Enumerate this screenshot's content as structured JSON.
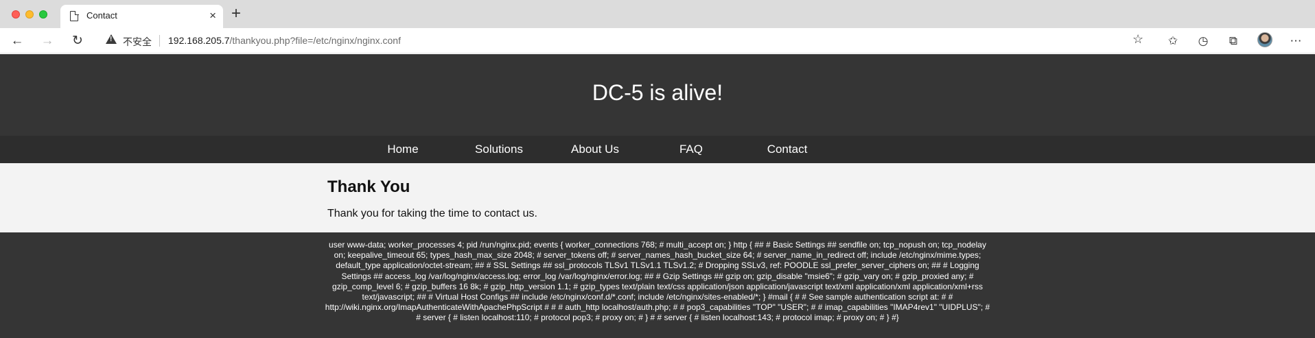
{
  "browser": {
    "tab_title": "Contact",
    "tab_close": "×",
    "new_tab": "+",
    "security_label": "不安全",
    "url_host": "192.168.205.7",
    "url_path": "/thankyou.php?file=/etc/nginx/nginx.conf",
    "icons": [
      "back-icon",
      "forward-icon",
      "reload-icon",
      "warning-icon",
      "add-favorite-icon",
      "favorites-icon",
      "history-icon",
      "collections-icon",
      "profile-avatar",
      "more-icon"
    ]
  },
  "site": {
    "title": "DC-5 is alive!",
    "nav": [
      "Home",
      "Solutions",
      "About Us",
      "FAQ",
      "Contact"
    ],
    "heading": "Thank You",
    "message": "Thank you for taking the time to contact us.",
    "file_contents": "user www-data; worker_processes 4; pid /run/nginx.pid; events { worker_connections 768; # multi_accept on; } http { ## # Basic Settings ## sendfile on; tcp_nopush on; tcp_nodelay on; keepalive_timeout 65; types_hash_max_size 2048; # server_tokens off; # server_names_hash_bucket_size 64; # server_name_in_redirect off; include /etc/nginx/mime.types; default_type application/octet-stream; ## # SSL Settings ## ssl_protocols TLSv1 TLSv1.1 TLSv1.2; # Dropping SSLv3, ref: POODLE ssl_prefer_server_ciphers on; ## # Logging Settings ## access_log /var/log/nginx/access.log; error_log /var/log/nginx/error.log; ## # Gzip Settings ## gzip on; gzip_disable \"msie6\"; # gzip_vary on; # gzip_proxied any; # gzip_comp_level 6; # gzip_buffers 16 8k; # gzip_http_version 1.1; # gzip_types text/plain text/css application/json application/javascript text/xml application/xml application/xml+rss text/javascript; ## # Virtual Host Configs ## include /etc/nginx/conf.d/*.conf; include /etc/nginx/sites-enabled/*; } #mail { # # See sample authentication script at: # # http://wiki.nginx.org/ImapAuthenticateWithApachePhpScript # # # auth_http localhost/auth.php; # # pop3_capabilities \"TOP\" \"USER\"; # # imap_capabilities \"IMAP4rev1\" \"UIDPLUS\"; # # server { # listen localhost:110; # protocol pop3; # proxy on; # } # # server { # listen localhost:143; # protocol imap; # proxy on; # } #}"
  }
}
